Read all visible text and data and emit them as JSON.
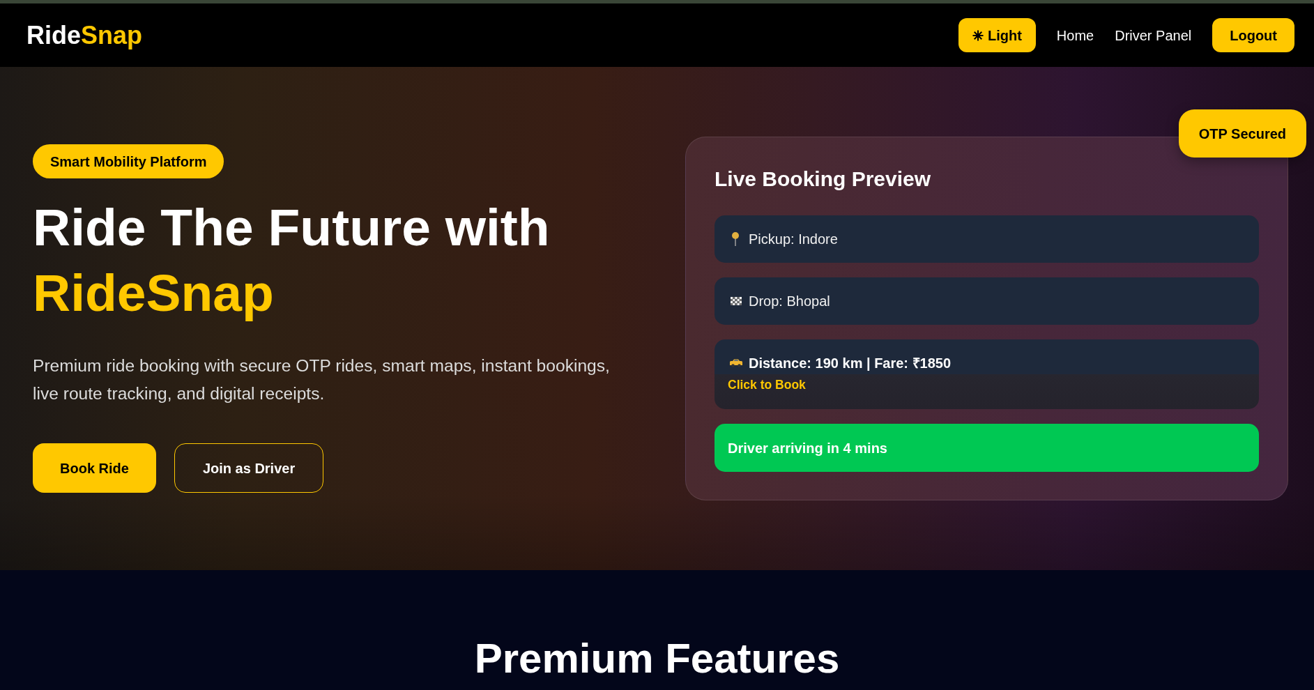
{
  "navbar": {
    "logo": {
      "primary": "Ride",
      "accent": "Snap"
    },
    "theme_button": {
      "label": "Light"
    },
    "links": [
      {
        "label": "Home"
      },
      {
        "label": "Driver Panel"
      }
    ],
    "logout_button": {
      "label": "Logout"
    }
  },
  "hero": {
    "badge": "Smart Mobility Platform",
    "title": "Ride The Future with",
    "title_accent": "RideSnap",
    "description": "Premium ride booking with secure OTP rides, smart maps, instant bookings, live route tracking, and digital receipts.",
    "buttons": [
      {
        "label": "Book Ride",
        "kind": "primary"
      },
      {
        "label": "Join as Driver",
        "kind": "outline"
      }
    ]
  },
  "preview_card": {
    "corner_badge": "OTP Secured",
    "title": "Live Booking Preview",
    "rows": [
      {
        "kind": "pickup",
        "text": "Pickup: Indore"
      },
      {
        "kind": "drop",
        "text": "Drop: Bhopal"
      },
      {
        "kind": "fare",
        "text": "Distance: 190 km | Fare: ₹1850",
        "action": "Click to Book"
      },
      {
        "kind": "status",
        "text": "Driver arriving in 4 mins"
      }
    ]
  },
  "features": {
    "title": "Premium Features"
  }
}
